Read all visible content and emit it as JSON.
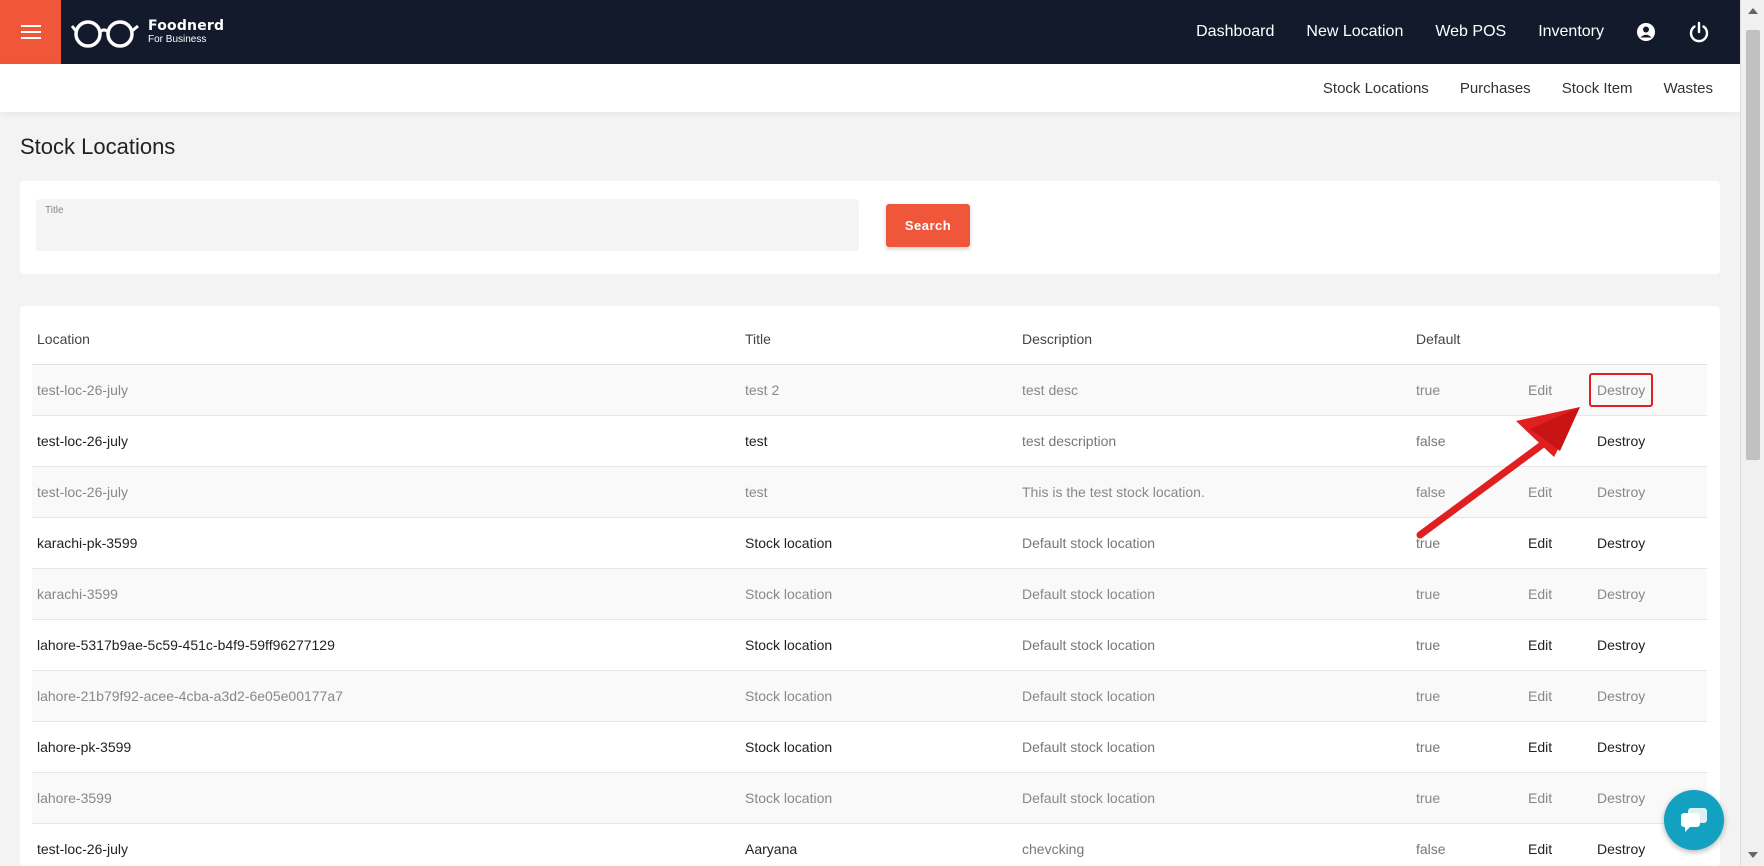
{
  "header": {
    "brand_name": "Foodnerd",
    "brand_sub": "For Business",
    "nav": [
      {
        "label": "Dashboard"
      },
      {
        "label": "New Location"
      },
      {
        "label": "Web POS"
      },
      {
        "label": "Inventory"
      }
    ],
    "icons": [
      "menu-icon",
      "glasses-logo-icon",
      "account-icon",
      "power-icon"
    ],
    "accent_color": "#f0563a",
    "bar_color": "#121a2b"
  },
  "subnav": [
    {
      "label": "Stock Locations"
    },
    {
      "label": "Purchases"
    },
    {
      "label": "Stock Item"
    },
    {
      "label": "Wastes"
    }
  ],
  "page": {
    "title": "Stock Locations"
  },
  "filter": {
    "title_label": "Title",
    "title_value": "",
    "search_label": "Search"
  },
  "table": {
    "headers": [
      "Location",
      "Title",
      "Description",
      "Default",
      "",
      ""
    ],
    "edit_label": "Edit",
    "destroy_label": "Destroy",
    "rows": [
      {
        "location": "test-loc-26-july",
        "title": "test 2",
        "description": "test desc",
        "default": "true"
      },
      {
        "location": "test-loc-26-july",
        "title": "test",
        "description": "test description",
        "default": "false"
      },
      {
        "location": "test-loc-26-july",
        "title": "test",
        "description": "This is the test stock location.",
        "default": "false"
      },
      {
        "location": "karachi-pk-3599",
        "title": "Stock location",
        "description": "Default stock location",
        "default": "true"
      },
      {
        "location": "karachi-3599",
        "title": "Stock location",
        "description": "Default stock location",
        "default": "true"
      },
      {
        "location": "lahore-5317b9ae-5c59-451c-b4f9-59ff96277129",
        "title": "Stock location",
        "description": "Default stock location",
        "default": "true"
      },
      {
        "location": "lahore-21b79f92-acee-4cba-a3d2-6e05e00177a7",
        "title": "Stock location",
        "description": "Default stock location",
        "default": "true"
      },
      {
        "location": "lahore-pk-3599",
        "title": "Stock location",
        "description": "Default stock location",
        "default": "true"
      },
      {
        "location": "lahore-3599",
        "title": "Stock location",
        "description": "Default stock location",
        "default": "true"
      },
      {
        "location": "test-loc-26-july",
        "title": "Aaryana",
        "description": "chevcking",
        "default": "false"
      }
    ]
  },
  "annotation": {
    "color": "#e02020",
    "highlighted": "Destroy"
  },
  "chat": {
    "icon": "chat-icon",
    "color": "#12a1c0"
  }
}
